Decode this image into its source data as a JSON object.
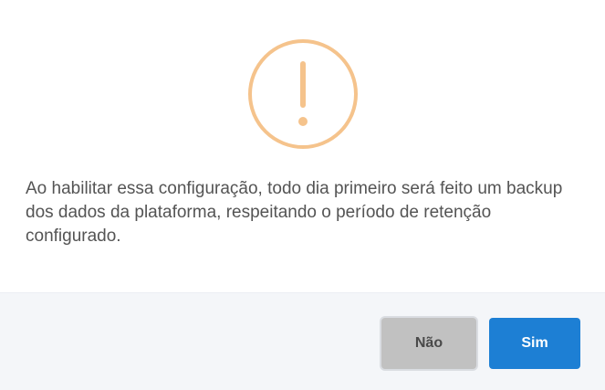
{
  "dialog": {
    "icon": "exclamation-circle-icon",
    "icon_color": "#f5c38c",
    "message": "Ao habilitar essa configuração, todo dia primeiro será feito um backup dos dados da plataforma, respeitando o período de retenção configurado.",
    "buttons": {
      "no_label": "Não",
      "yes_label": "Sim"
    },
    "colors": {
      "primary": "#1d7fd4",
      "secondary": "#c1c1c1",
      "footer_bg": "#f4f6f9"
    }
  }
}
